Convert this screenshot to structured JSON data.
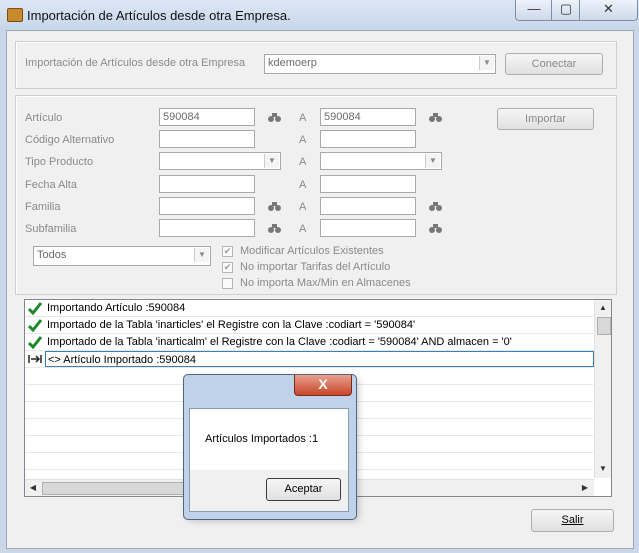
{
  "window": {
    "title": "Importación de Artículos desde otra Empresa.",
    "controls": {
      "minimize": "—",
      "maximize": "▢",
      "close": "✕"
    }
  },
  "company": {
    "label": "Importación de Artículos desde otra Empresa",
    "value": "kdemoerp",
    "connect_label": "Conectar"
  },
  "filters": {
    "range_sep": "A",
    "import_label": "Importar",
    "rows": [
      {
        "label": "Artículo",
        "from": "590084",
        "to": "590084"
      },
      {
        "label": "Código Alternativo",
        "from": "",
        "to": ""
      },
      {
        "label": "Tipo Producto",
        "from": "",
        "to": ""
      },
      {
        "label": "Fecha Alta",
        "from": "",
        "to": ""
      },
      {
        "label": "Familia",
        "from": "",
        "to": ""
      },
      {
        "label": "Subfamilia",
        "from": "",
        "to": ""
      }
    ],
    "scope_value": "Todos",
    "options": [
      {
        "label": "Modificar Artículos Existentes",
        "checked": true
      },
      {
        "label": "No importar Tarifas del Artículo",
        "checked": true
      },
      {
        "label": "No importa Max/Min en Almacenes",
        "checked": false
      }
    ]
  },
  "log": {
    "rows": [
      {
        "icon": "check-icon",
        "text": "Importando Artículo :590084"
      },
      {
        "icon": "check-icon",
        "text": "Importado de la Tabla 'inarticles' el Registre con la Clave :codiart = '590084'"
      },
      {
        "icon": "check-icon",
        "text": "Importado de la Tabla 'inarticalm' el Registre con la Clave :codiart = '590084' AND almacen = '0'"
      },
      {
        "icon": "arrows-icon",
        "text": "<> Artículo Importado :590084"
      }
    ]
  },
  "dialog": {
    "message": "Artículos Importados :1",
    "ok_label": "Aceptar",
    "close": "X"
  },
  "exit_label": "Salir",
  "colors": {
    "accent": "#c7462a",
    "check": "#1d8a2a"
  }
}
